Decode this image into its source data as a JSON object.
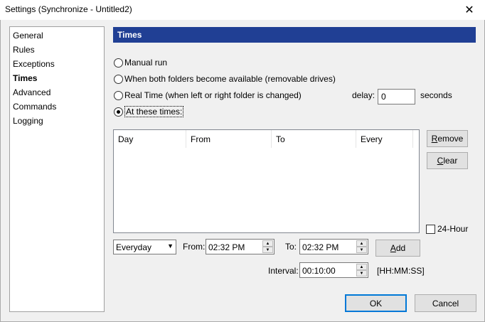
{
  "window": {
    "title": "Settings (Synchronize - Untitled2)",
    "close_glyph": "✕"
  },
  "sidebar": {
    "items": [
      {
        "label": "General"
      },
      {
        "label": "Rules"
      },
      {
        "label": "Exceptions"
      },
      {
        "label": "Times",
        "active": true
      },
      {
        "label": "Advanced"
      },
      {
        "label": "Commands"
      },
      {
        "label": "Logging"
      }
    ]
  },
  "header": {
    "title": "Times"
  },
  "radios": [
    {
      "label": "Manual run",
      "checked": false
    },
    {
      "label": "When both folders become available (removable drives)",
      "checked": false
    },
    {
      "label": "Real Time (when left or right folder is changed)",
      "checked": false
    },
    {
      "label": "At these times:",
      "checked": true
    }
  ],
  "delay": {
    "label": "delay:",
    "value": "0",
    "unit": "seconds"
  },
  "table": {
    "columns": [
      "Day",
      "From",
      "To",
      "Every"
    ],
    "rows": []
  },
  "buttons": {
    "remove": {
      "prefix": "",
      "accel": "R",
      "rest": "emove"
    },
    "clear": {
      "prefix": "",
      "accel": "C",
      "rest": "lear"
    },
    "add": {
      "prefix": "",
      "accel": "A",
      "rest": "dd"
    },
    "ok": "OK",
    "cancel": "Cancel"
  },
  "hour24": {
    "label": "24-Hour",
    "checked": false
  },
  "day_select": {
    "value": "Everyday"
  },
  "from": {
    "label": "From:",
    "value": "02:32 PM"
  },
  "to": {
    "label": "To:",
    "value": "02:32 PM"
  },
  "interval": {
    "label": "Interval:",
    "value": "00:10:00",
    "hint": "[HH:MM:SS]"
  },
  "colors": {
    "header_bg": "#203f94",
    "default_button_border": "#0078d7"
  }
}
